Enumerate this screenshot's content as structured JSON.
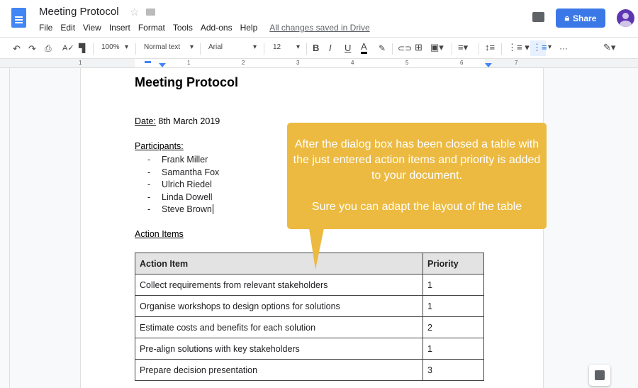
{
  "header": {
    "title": "Meeting Protocol",
    "menus": [
      "File",
      "Edit",
      "View",
      "Insert",
      "Format",
      "Tools",
      "Add-ons",
      "Help"
    ],
    "saved_status": "All changes saved in Drive",
    "share_label": "Share"
  },
  "toolbar": {
    "zoom": "100%",
    "style": "Normal text",
    "font": "Arial",
    "size": "12",
    "bold": "B",
    "italic": "I",
    "underline": "U",
    "text_color": "A",
    "more": "···"
  },
  "ruler": {
    "labels": [
      "1",
      "1",
      "2",
      "3",
      "4",
      "5",
      "6",
      "7"
    ]
  },
  "document": {
    "heading": "Meeting Protocol",
    "date_label": "Date:",
    "date_value": " 8th March 2019",
    "participants_label": "Participants:",
    "participants": [
      "Frank Miller",
      "Samantha Fox",
      "Ulrich Riedel",
      "Linda Dowell",
      "Steve Brown"
    ],
    "bullet": "-",
    "action_items_label": "Action Items",
    "table": {
      "headers": [
        "Action Item",
        "Priority"
      ],
      "rows": [
        [
          "Collect requirements from relevant stakeholders",
          "1"
        ],
        [
          "Organise workshops to design options for solutions",
          "1"
        ],
        [
          "Estimate costs and benefits for each solution",
          "2"
        ],
        [
          "Pre-align solutions with key stakeholders",
          "1"
        ],
        [
          "Prepare decision presentation",
          "3"
        ]
      ]
    }
  },
  "callout": {
    "line1": "After the dialog box has been closed a table with the just entered action items and priority is added to your document.",
    "line2": "Sure you can adapt the layout of the table",
    "color": "#ecba41"
  },
  "colors": {
    "share": "#3b78e7",
    "avatar": "#5e35b1"
  }
}
